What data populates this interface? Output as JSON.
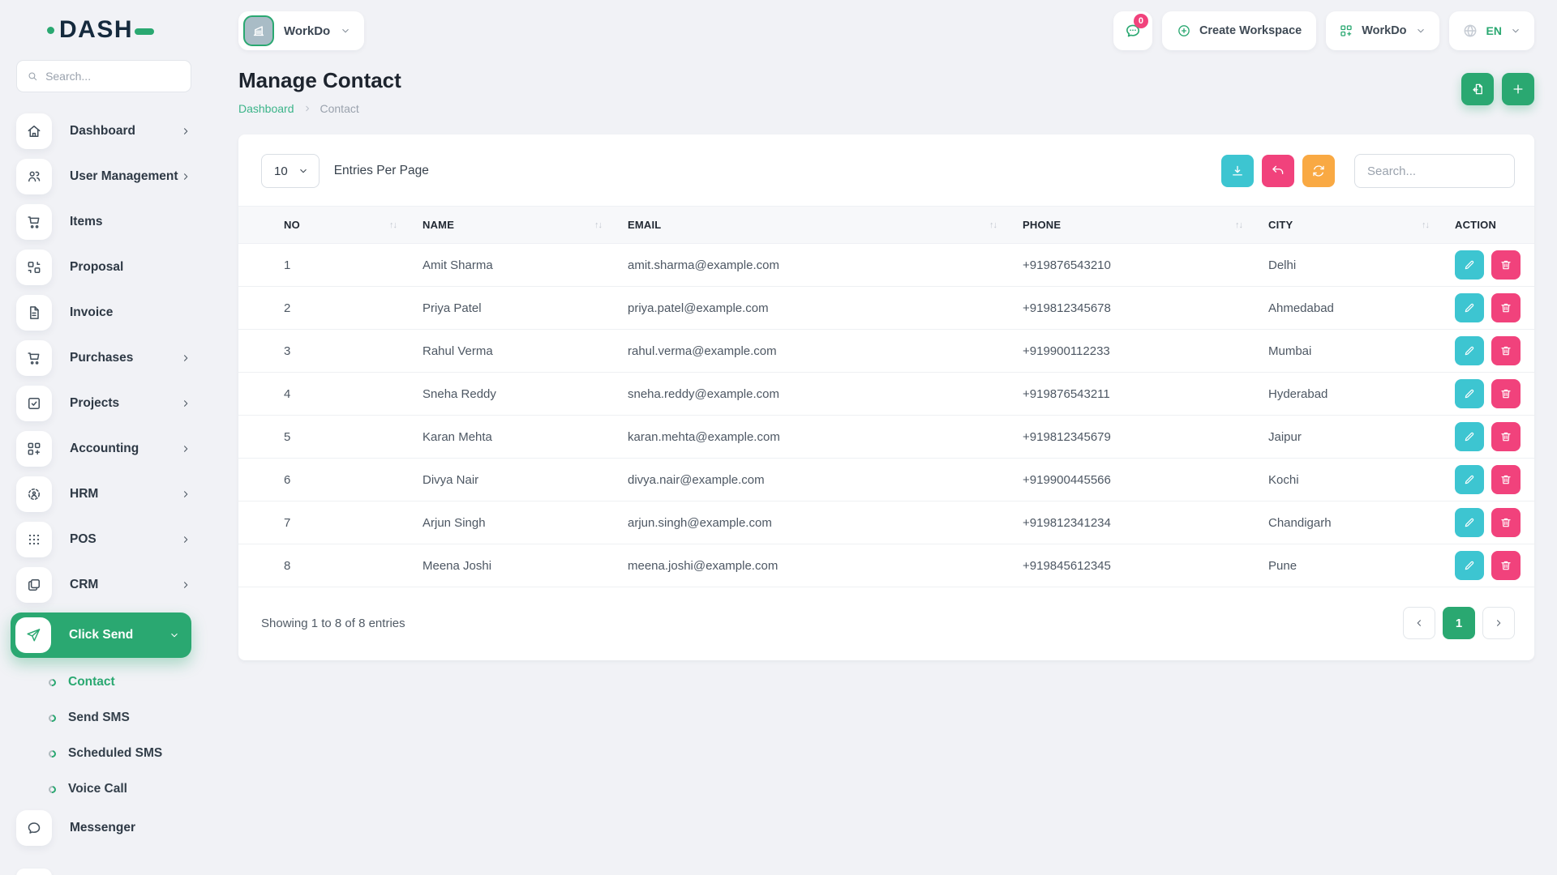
{
  "app": {
    "logo_text": "DASH"
  },
  "colors": {
    "primary_green": "#2aa871",
    "link_green": "#3bb489",
    "teal": "#3dc5d1",
    "pink": "#f1427c",
    "orange": "#f9a943",
    "badge_pink": "#f1427c"
  },
  "icons": {
    "sort_glyph": "↑↓"
  },
  "sidebar": {
    "search_placeholder": "Search...",
    "items": [
      {
        "label": "Dashboard",
        "icon": "home-icon"
      },
      {
        "label": "User Management",
        "icon": "users-icon"
      },
      {
        "label": "Items",
        "icon": "cart-icon"
      },
      {
        "label": "Proposal",
        "icon": "proposal-boxes-icon"
      },
      {
        "label": "Invoice",
        "icon": "invoice-file-icon"
      },
      {
        "label": "Purchases",
        "icon": "cart-icon"
      },
      {
        "label": "Projects",
        "icon": "check-square-icon"
      },
      {
        "label": "Accounting",
        "icon": "grid-plus-icon"
      },
      {
        "label": "HRM",
        "icon": "hrm-person-icon"
      },
      {
        "label": "POS",
        "icon": "dots-grid-icon"
      },
      {
        "label": "CRM",
        "icon": "cards-icon"
      }
    ],
    "click_send": {
      "label": "Click Send",
      "icon": "paper-plane-icon"
    },
    "sub_items": [
      {
        "label": "Contact",
        "active": true
      },
      {
        "label": "Send SMS",
        "active": false
      },
      {
        "label": "Scheduled SMS",
        "active": false
      },
      {
        "label": "Voice Call",
        "active": false
      }
    ],
    "messenger": {
      "label": "Messenger",
      "icon": "chat-bubble-icon"
    }
  },
  "header": {
    "workspace_name": "WorkDo",
    "messages_badge": "0",
    "create_workspace_label": "Create Workspace",
    "account_name": "WorkDo",
    "language": "EN"
  },
  "page": {
    "title": "Manage Contact",
    "breadcrumb_home": "Dashboard",
    "breadcrumb_current": "Contact"
  },
  "toolbar": {
    "entries_value": "10",
    "entries_label": "Entries Per Page",
    "search_placeholder": "Search..."
  },
  "table": {
    "columns": [
      "NO",
      "NAME",
      "EMAIL",
      "PHONE",
      "CITY",
      "ACTION"
    ],
    "rows": [
      {
        "no": "1",
        "name": "Amit Sharma",
        "email": "amit.sharma@example.com",
        "phone": "+919876543210",
        "city": "Delhi"
      },
      {
        "no": "2",
        "name": "Priya Patel",
        "email": "priya.patel@example.com",
        "phone": "+919812345678",
        "city": "Ahmedabad"
      },
      {
        "no": "3",
        "name": "Rahul Verma",
        "email": "rahul.verma@example.com",
        "phone": "+919900112233",
        "city": "Mumbai"
      },
      {
        "no": "4",
        "name": "Sneha Reddy",
        "email": "sneha.reddy@example.com",
        "phone": "+919876543211",
        "city": "Hyderabad"
      },
      {
        "no": "5",
        "name": "Karan Mehta",
        "email": "karan.mehta@example.com",
        "phone": "+919812345679",
        "city": "Jaipur"
      },
      {
        "no": "6",
        "name": "Divya Nair",
        "email": "divya.nair@example.com",
        "phone": "+919900445566",
        "city": "Kochi"
      },
      {
        "no": "7",
        "name": "Arjun Singh",
        "email": "arjun.singh@example.com",
        "phone": "+919812341234",
        "city": "Chandigarh"
      },
      {
        "no": "8",
        "name": "Meena Joshi",
        "email": "meena.joshi@example.com",
        "phone": "+919845612345",
        "city": "Pune"
      }
    ]
  },
  "footer": {
    "showing_text": "Showing 1 to 8 of 8 entries",
    "page": "1"
  }
}
